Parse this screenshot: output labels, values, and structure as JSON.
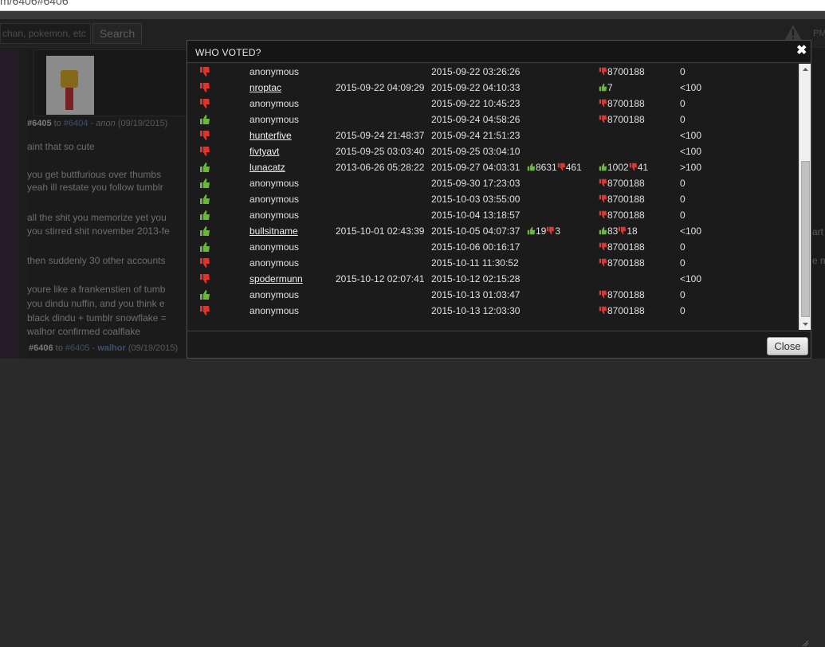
{
  "browser": {
    "url_fragment": "m/6406#6406"
  },
  "header": {
    "search_placeholder": "chan, pokemon, etc",
    "search_button": "Search",
    "right_text": "PM",
    "warning_icon": "warning-triangle-icon"
  },
  "background": {
    "post_6405_head": {
      "id": "#6405",
      "to_word": "to",
      "to_id": "#6404",
      "sep": "-",
      "author": "anon",
      "date": "(09/19/2015)"
    },
    "lines": [
      "aint that so cute",
      "you get buttfurious over thumbs",
      "yeah ill restate you follow tumblr",
      "all the shit you memorize yet you",
      "you stirred shit november 2013-fe",
      "then suddenly 30 other accounts",
      "youre like a frankenstien of tumb",
      "you dindu nuffin, and you think e",
      "black dindu + tumblr snowflake =",
      "walhor confirmed coalflake"
    ],
    "post_6406_head": {
      "id": "#6406",
      "to_word": "to",
      "to_id": "#6405",
      "sep": "-",
      "author": "walhor",
      "date": "(09/19/2015)"
    },
    "right_fragments": [
      "art",
      "e n"
    ]
  },
  "modal": {
    "title": "WHO VOTED?",
    "close_icon": "close-x-icon",
    "close_button": "Close",
    "colors": {
      "up": "#66bb33",
      "down": "#e0332b"
    },
    "rows": [
      {
        "vote": "down",
        "user": "anonymous",
        "is_link": false,
        "joined": "",
        "voted": "2015-09-22 03:26:26",
        "post_up": "",
        "post_down": "",
        "user_up": "",
        "user_down": "8700188",
        "rank": "0"
      },
      {
        "vote": "down",
        "user": "nroptac",
        "is_link": true,
        "joined": "2015-09-22 04:09:29",
        "voted": "2015-09-22 04:10:33",
        "post_up": "",
        "post_down": "",
        "user_up": "7",
        "user_down": "",
        "rank": "<100"
      },
      {
        "vote": "down",
        "user": "anonymous",
        "is_link": false,
        "joined": "",
        "voted": "2015-09-22 10:45:23",
        "post_up": "",
        "post_down": "",
        "user_up": "",
        "user_down": "8700188",
        "rank": "0"
      },
      {
        "vote": "up",
        "user": "anonymous",
        "is_link": false,
        "joined": "",
        "voted": "2015-09-24 04:58:26",
        "post_up": "",
        "post_down": "",
        "user_up": "",
        "user_down": "8700188",
        "rank": "0"
      },
      {
        "vote": "down",
        "user": "hunterfive",
        "is_link": true,
        "joined": "2015-09-24 21:48:37",
        "voted": "2015-09-24 21:51:23",
        "post_up": "",
        "post_down": "",
        "user_up": "",
        "user_down": "",
        "rank": "<100"
      },
      {
        "vote": "down",
        "user": "fivtyavt",
        "is_link": true,
        "joined": "2015-09-25 03:03:40",
        "voted": "2015-09-25 03:04:10",
        "post_up": "",
        "post_down": "",
        "user_up": "",
        "user_down": "",
        "rank": "<100"
      },
      {
        "vote": "up",
        "user": "lunacatz",
        "is_link": true,
        "joined": "2013-06-26 05:28:22",
        "voted": "2015-09-27 04:03:31",
        "post_up": "8631",
        "post_down": "461",
        "user_up": "1002",
        "user_down": "41",
        "rank": ">100"
      },
      {
        "vote": "up",
        "user": "anonymous",
        "is_link": false,
        "joined": "",
        "voted": "2015-09-30 17:23:03",
        "post_up": "",
        "post_down": "",
        "user_up": "",
        "user_down": "8700188",
        "rank": "0"
      },
      {
        "vote": "up",
        "user": "anonymous",
        "is_link": false,
        "joined": "",
        "voted": "2015-10-03 03:55:00",
        "post_up": "",
        "post_down": "",
        "user_up": "",
        "user_down": "8700188",
        "rank": "0"
      },
      {
        "vote": "up",
        "user": "anonymous",
        "is_link": false,
        "joined": "",
        "voted": "2015-10-04 13:18:57",
        "post_up": "",
        "post_down": "",
        "user_up": "",
        "user_down": "8700188",
        "rank": "0"
      },
      {
        "vote": "up",
        "user": "bullsitname",
        "is_link": true,
        "joined": "2015-10-01 02:43:39",
        "voted": "2015-10-05 04:07:37",
        "post_up": "19",
        "post_down": "3",
        "user_up": "83",
        "user_down": "18",
        "rank": "<100"
      },
      {
        "vote": "up",
        "user": "anonymous",
        "is_link": false,
        "joined": "",
        "voted": "2015-10-06 00:16:17",
        "post_up": "",
        "post_down": "",
        "user_up": "",
        "user_down": "8700188",
        "rank": "0"
      },
      {
        "vote": "down",
        "user": "anonymous",
        "is_link": false,
        "joined": "",
        "voted": "2015-10-11 11:30:52",
        "post_up": "",
        "post_down": "",
        "user_up": "",
        "user_down": "8700188",
        "rank": "0"
      },
      {
        "vote": "down",
        "user": "spodermunn",
        "is_link": true,
        "joined": "2015-10-12 02:07:41",
        "voted": "2015-10-12 02:15:28",
        "post_up": "",
        "post_down": "",
        "user_up": "",
        "user_down": "",
        "rank": "<100"
      },
      {
        "vote": "up",
        "user": "anonymous",
        "is_link": false,
        "joined": "",
        "voted": "2015-10-13 01:03:47",
        "post_up": "",
        "post_down": "",
        "user_up": "",
        "user_down": "8700188",
        "rank": "0"
      },
      {
        "vote": "down",
        "user": "anonymous",
        "is_link": false,
        "joined": "",
        "voted": "2015-10-13 12:03:30",
        "post_up": "",
        "post_down": "",
        "user_up": "",
        "user_down": "8700188",
        "rank": "0"
      }
    ]
  }
}
